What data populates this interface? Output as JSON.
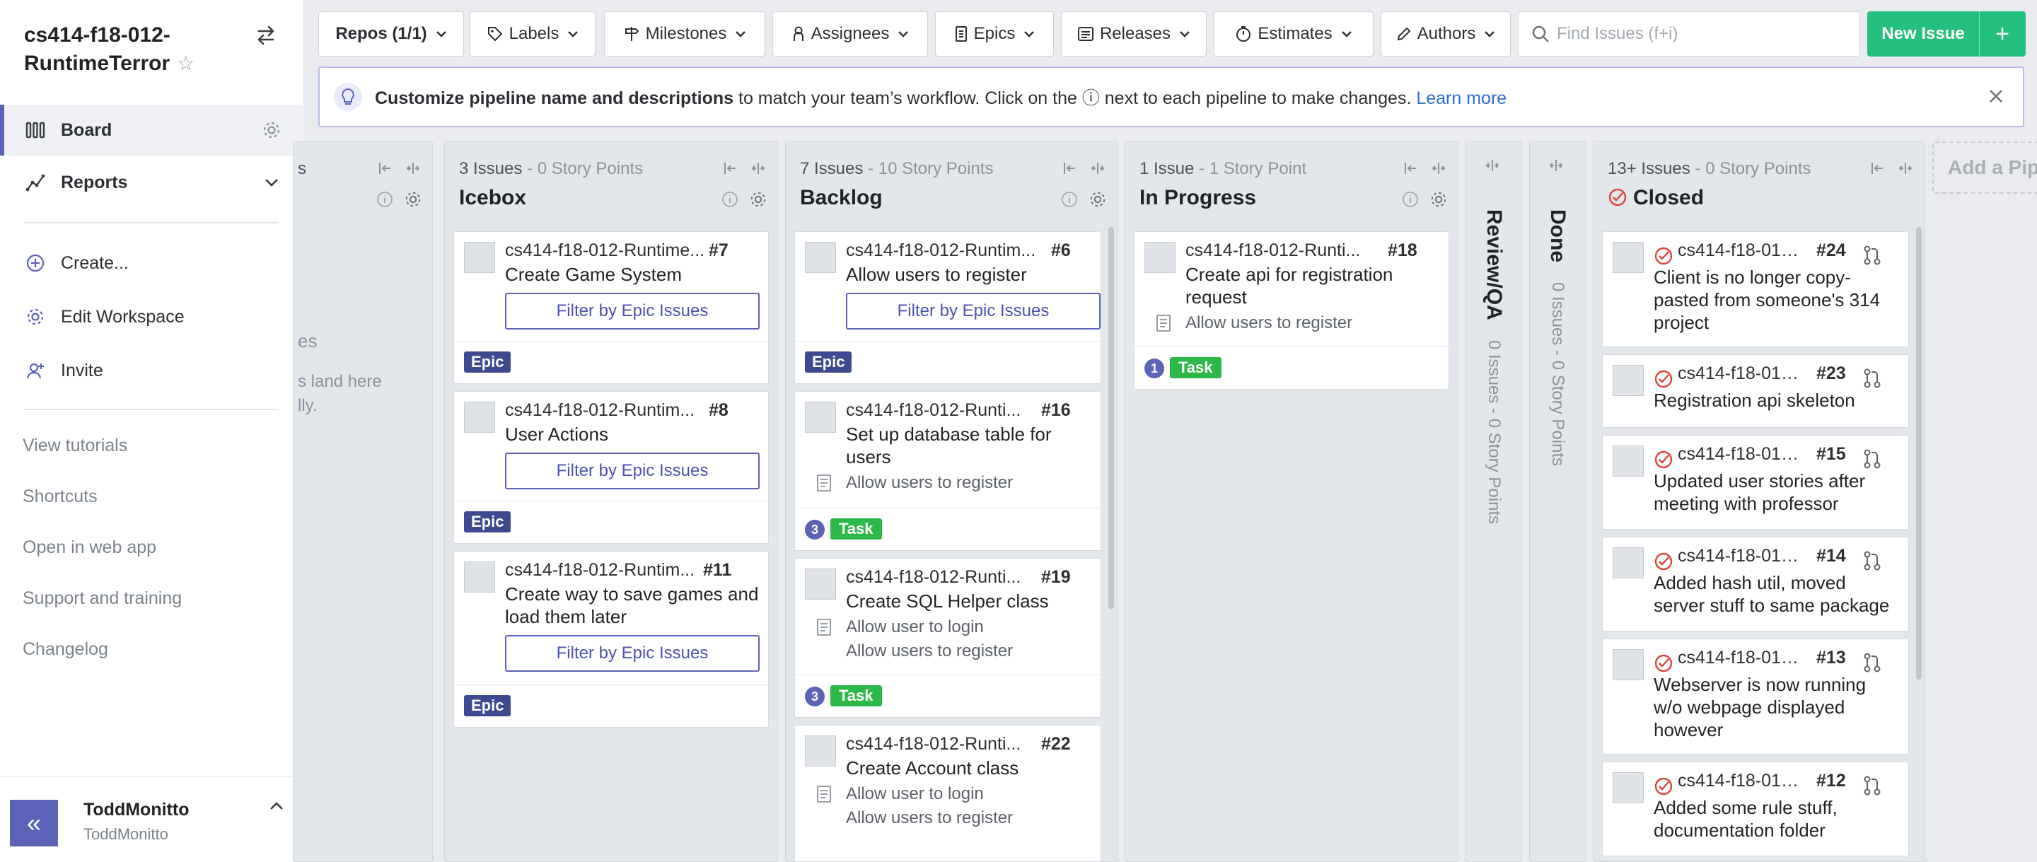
{
  "workspace": {
    "name": "cs414-f18-012-RuntimeTerror"
  },
  "nav": {
    "board": "Board",
    "reports": "Reports",
    "create": "Create...",
    "edit_workspace": "Edit Workspace",
    "invite": "Invite"
  },
  "links": {
    "view_tutorials": "View tutorials",
    "shortcuts": "Shortcuts",
    "open_web": "Open in web app",
    "support": "Support and training",
    "changelog": "Changelog"
  },
  "user": {
    "name": "ToddMonitto",
    "handle": "ToddMonitto",
    "collapse": "«"
  },
  "toolbar": {
    "repos": "Repos (1/1)",
    "labels": "Labels",
    "milestones": "Milestones",
    "assignees": "Assignees",
    "epics": "Epics",
    "releases": "Releases",
    "estimates": "Estimates",
    "authors": "Authors",
    "search_placeholder": "Find Issues (f+i)",
    "new_issue": "New Issue",
    "new_plus": "+"
  },
  "banner": {
    "bold": "Customize pipeline name and descriptions",
    "text": " to match your team’s workflow. Click on the ⓘ next to each pipeline to make changes. ",
    "link": "Learn more"
  },
  "partial_column": {
    "text1": "es",
    "text2": "s land here",
    "text3": "lly."
  },
  "pipelines": {
    "icebox": {
      "count": "3 Issues",
      "points": " - 0 Story Points",
      "name": "Icebox",
      "cards": [
        {
          "repo": "cs414-f18-012-Runtime...",
          "num": "#7",
          "title": "Create Game System",
          "epic_btn": "Filter by Epic Issues",
          "label": "Epic"
        },
        {
          "repo": "cs414-f18-012-Runtim...",
          "num": "#8",
          "title": "User Actions",
          "epic_btn": "Filter by Epic Issues",
          "label": "Epic"
        },
        {
          "repo": "cs414-f18-012-Runtim...",
          "num": "#11",
          "title": "Create way to save games and load them later",
          "epic_btn": "Filter by Epic Issues",
          "label": "Epic"
        }
      ]
    },
    "backlog": {
      "count": "7 Issues",
      "points": " - 10 Story Points",
      "name": "Backlog",
      "cards": [
        {
          "repo": "cs414-f18-012-Runtim...",
          "num": "#6",
          "title": "Allow users to register",
          "epic_btn": "Filter by Epic Issues",
          "label": "Epic"
        },
        {
          "repo": "cs414-f18-012-Runti...",
          "num": "#16",
          "title": "Set up database table for users",
          "linked": [
            "Allow users to register"
          ],
          "estimate": "3",
          "label": "Task"
        },
        {
          "repo": "cs414-f18-012-Runti...",
          "num": "#19",
          "title": "Create SQL Helper class",
          "linked": [
            "Allow user to login",
            "Allow users to register"
          ],
          "estimate": "3",
          "label": "Task"
        },
        {
          "repo": "cs414-f18-012-Runti...",
          "num": "#22",
          "title": "Create Account class",
          "linked": [
            "Allow user to login",
            "Allow users to register"
          ]
        }
      ]
    },
    "in_progress": {
      "count": "1 Issue",
      "points": " - 1 Story Point",
      "name": "In Progress",
      "cards": [
        {
          "repo": "cs414-f18-012-Runti...",
          "num": "#18",
          "title": "Create api for registration request",
          "linked": [
            "Allow users to register"
          ],
          "estimate": "1",
          "label": "Task"
        }
      ]
    },
    "review": {
      "name": "Review/QA",
      "meta": "0 Issues - 0 Story Points"
    },
    "done": {
      "name": "Done",
      "meta": "0 Issues - 0 Story Points"
    },
    "closed": {
      "count": "13+ Issues",
      "points": " - 0 Story Points",
      "name": "Closed",
      "cards": [
        {
          "repo": "cs414-f18-012...",
          "num": "#24",
          "title": "Client is no longer copy-pasted from someone's 314 project"
        },
        {
          "repo": "cs414-f18-012...",
          "num": "#23",
          "title": "Registration api skeleton"
        },
        {
          "repo": "cs414-f18-012...",
          "num": "#15",
          "title": "Updated user stories after meeting with professor"
        },
        {
          "repo": "cs414-f18-012...",
          "num": "#14",
          "title": "Added hash util, moved server stuff to same package"
        },
        {
          "repo": "cs414-f18-012...",
          "num": "#13",
          "title": "Webserver is now running w/o webpage displayed however"
        },
        {
          "repo": "cs414-f18-012...",
          "num": "#12",
          "title": "Added some rule stuff, documentation folder"
        }
      ]
    }
  },
  "add_pipeline": "Add a Pipeline",
  "colors": {
    "accent": "#5a63b8",
    "green": "#25c07e",
    "task": "#2fb84a",
    "epic": "#3e4a8f",
    "closed_red": "#e0443a"
  }
}
